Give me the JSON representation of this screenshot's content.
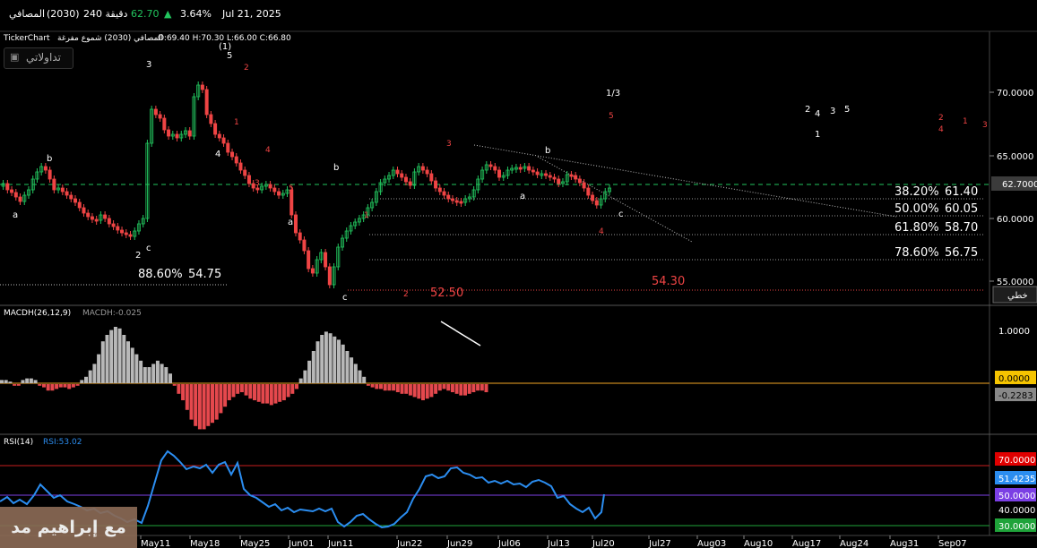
{
  "header": {
    "name": "المصافي",
    "code": "(2030)",
    "interval": "240 دقيقة",
    "price": "62.70",
    "change": "3.64%",
    "date": "Jul 21, 2025"
  },
  "chart_info": {
    "source": "TickerChart",
    "title": "المصافي (2030) شموع مفرغة",
    "ohlc": "O:69.40  H:70.30  L:66.00  C:66.80",
    "logo_text": "تداولاتي",
    "scale_button": "خطي"
  },
  "price_axis": {
    "ticks": [
      "70.0000",
      "65.0000",
      "60.0000",
      "55.0000"
    ],
    "current": "62.7000"
  },
  "fib_levels": [
    {
      "pct": "38.20%",
      "val": "61.40"
    },
    {
      "pct": "50.00%",
      "val": "60.05"
    },
    {
      "pct": "61.80%",
      "val": "58.70"
    },
    {
      "pct": "78.60%",
      "val": "56.75"
    }
  ],
  "left_fib": {
    "pct": "88.60%",
    "val": "54.75"
  },
  "levels": {
    "low_label": "52.50",
    "target_label": "54.30"
  },
  "wave_labels": {
    "top_one": "(1)",
    "five": "5",
    "three_w": "3",
    "b1": "b",
    "a1": "a",
    "c1": "c",
    "two1": "2",
    "four1": "4",
    "b2": "b",
    "a2": "a",
    "c2": "c",
    "b3": "b",
    "a3": "a",
    "c3": "c",
    "one_third": "1/3",
    "r2": "2",
    "r1": "1",
    "r4": "4",
    "r3": "3",
    "r5": "5",
    "r_c1": "1",
    "r_c2": "2",
    "r_c3": "3",
    "r_c4": "4",
    "r_c5": "5",
    "fut_w": [
      "2",
      "4",
      "3",
      "5",
      "1"
    ],
    "fut_r": [
      "2",
      "1",
      "3",
      "4"
    ]
  },
  "macd": {
    "label": "MACDH(26,12,9)",
    "value": "MACDH:-0.025",
    "ticks": [
      "1.0000"
    ],
    "zero": "0.0000",
    "current": "-0.2283"
  },
  "rsi": {
    "label": "RSI(14)",
    "value": "RSI:53.02",
    "upper": "70.0000",
    "current": "51.4235",
    "mid": "50.0000",
    "tick": "40.0000",
    "lower": "30.0000"
  },
  "x_axis": [
    "May11",
    "May18",
    "May25",
    "Jun01",
    "Jun11",
    "Jun22",
    "Jun29",
    "Jul06",
    "Jul13",
    "Jul20",
    "Jul27",
    "Aug03",
    "Aug10",
    "Aug17",
    "Aug24",
    "Aug31",
    "Sep07"
  ],
  "watermark": "مع إبراهيم مد",
  "colors": {
    "up": "#22c55e",
    "down": "#ef4444",
    "macd_pos": "#b8b8b8",
    "macd_neg": "#e5484d",
    "rsi": "#2b8df0",
    "fib": "#ffffff"
  }
}
